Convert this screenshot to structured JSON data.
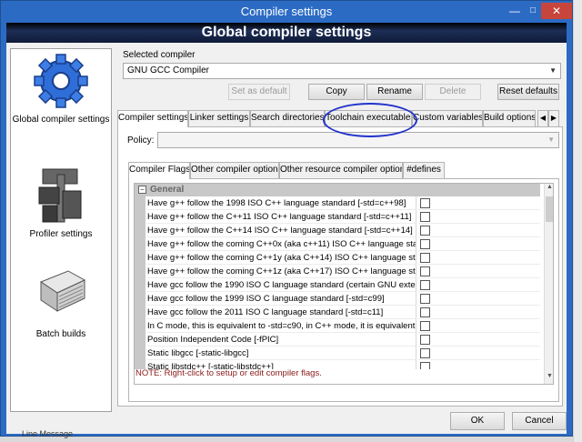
{
  "window": {
    "title": "Compiler settings"
  },
  "header": {
    "title": "Global compiler settings"
  },
  "left_panel": {
    "items": [
      {
        "label": "Global compiler settings",
        "icon": "gear-icon"
      },
      {
        "label": "Profiler settings",
        "icon": "profiler-icon"
      },
      {
        "label": "Batch builds",
        "icon": "batch-builds-icon"
      }
    ]
  },
  "compiler": {
    "label": "Selected compiler",
    "value": "GNU GCC Compiler",
    "buttons": {
      "set_default": "Set as default",
      "copy": "Copy",
      "rename": "Rename",
      "delete": "Delete",
      "reset": "Reset defaults"
    }
  },
  "tabs": [
    "Compiler settings",
    "Linker settings",
    "Search directories",
    "Toolchain executables",
    "Custom variables",
    "Build options"
  ],
  "policy": {
    "label": "Policy:",
    "value": ""
  },
  "subtabs": [
    "Compiler Flags",
    "Other compiler options",
    "Other resource compiler options",
    "#defines"
  ],
  "flags": {
    "group": "General",
    "rows": [
      "Have g++ follow the 1998 ISO C++ language standard  [-std=c++98]",
      "Have g++ follow the C++11 ISO C++ language standard  [-std=c++11]",
      "Have g++ follow the C++14 ISO C++ language standard  [-std=c++14]",
      "Have g++ follow the coming C++0x (aka c++11) ISO C++ language stan",
      "Have g++ follow the coming C++1y (aka C++14) ISO C++ language star",
      "Have g++ follow the coming C++1z (aka C++17) ISO C++ language stan",
      "Have gcc follow the 1990 ISO C language standard  (certain GNU extensio",
      "Have gcc follow the 1999 ISO C language standard  [-std=c99]",
      "Have gcc follow the 2011 ISO C language standard  [-std=c11]",
      "In C mode, this is equivalent to -std=c90, in C++ mode, it is equivalent to",
      "Position Independent Code  [-fPIC]",
      "Static libgcc  [-static-libgcc]",
      "Static libstdc++  [-static-libstdc++]"
    ],
    "note": "NOTE: Right-click to setup or edit compiler flags."
  },
  "footer": {
    "ok": "OK",
    "cancel": "Cancel"
  },
  "behind_text": "Line    Message",
  "colors": {
    "titlebar": "#2b6bc4",
    "close": "#c7453b",
    "annotation": "#2233cc"
  }
}
